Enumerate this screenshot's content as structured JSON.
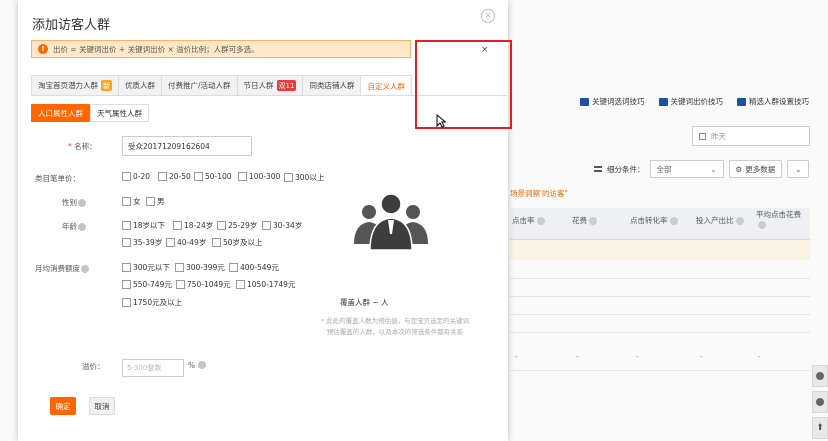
{
  "modal": {
    "title": "添加访客人群",
    "close_glyph": "×",
    "alert_icon": "!",
    "alert_text": "出价 = 关键词出价 + 关键词出价 × 溢价比例；人群可多选。",
    "alert_close": "×"
  },
  "tabs": [
    {
      "label": "淘宝首页潜力人群",
      "badge": "新"
    },
    {
      "label": "优质人群",
      "badge": ""
    },
    {
      "label": "付费推广/活动人群",
      "badge": ""
    },
    {
      "label": "节日人群",
      "badge": "双11"
    },
    {
      "label": "同类店铺人群",
      "badge": ""
    },
    {
      "label": "自定义人群",
      "badge": ""
    }
  ],
  "subtabs": [
    "人口属性人群",
    "天气属性人群"
  ],
  "form": {
    "name_label": "名称：",
    "name_required": "*",
    "name_value": "受众20171209162604",
    "price_label": "类目笔单价：",
    "price_options": [
      "0-20",
      "20-50",
      "50-100",
      "100-300",
      "300以上"
    ],
    "gender_label": "性别",
    "gender_options": [
      "女",
      "男"
    ],
    "age_label": "年龄",
    "age_options": [
      "18岁以下",
      "18-24岁",
      "25-29岁",
      "30-34岁",
      "35-39岁",
      "40-49岁",
      "50岁及以上"
    ],
    "spend_label": "月均消费额度",
    "spend_options": [
      "300元以下",
      "300-399元",
      "400-549元",
      "550-749元",
      "750-1049元",
      "1050-1749元",
      "1750元及以上"
    ],
    "bid_label": "溢价：",
    "bid_placeholder": "5-300整数",
    "bid_unit": "%"
  },
  "preview": {
    "cover_text": "覆盖人群 ~ 人",
    "note": "* 此处的覆盖人数为预估值，与您宝贝选定的关键词预估覆盖的人群，以及本次的筛选条件都有关系"
  },
  "buttons": {
    "confirm": "确定",
    "cancel": "取消"
  },
  "background": {
    "links": [
      "关键词选词技巧",
      "关键词出价技巧",
      "精选人群设置技巧"
    ],
    "date_placeholder": "昨天",
    "filter_label": "细分条件：",
    "filter_value": "全部",
    "more_data": "更多数据",
    "orange_note": "场景洞察'的访客\"",
    "table_headers": [
      "点击率",
      "花费",
      "点击转化率",
      "投入产出比",
      "平均点击花费"
    ],
    "dash": "-"
  },
  "colors": {
    "accent": "#ff6600",
    "alert_bg": "#ffe8c8",
    "annotation": "#e02020",
    "link_icon": "#1e50a0"
  }
}
